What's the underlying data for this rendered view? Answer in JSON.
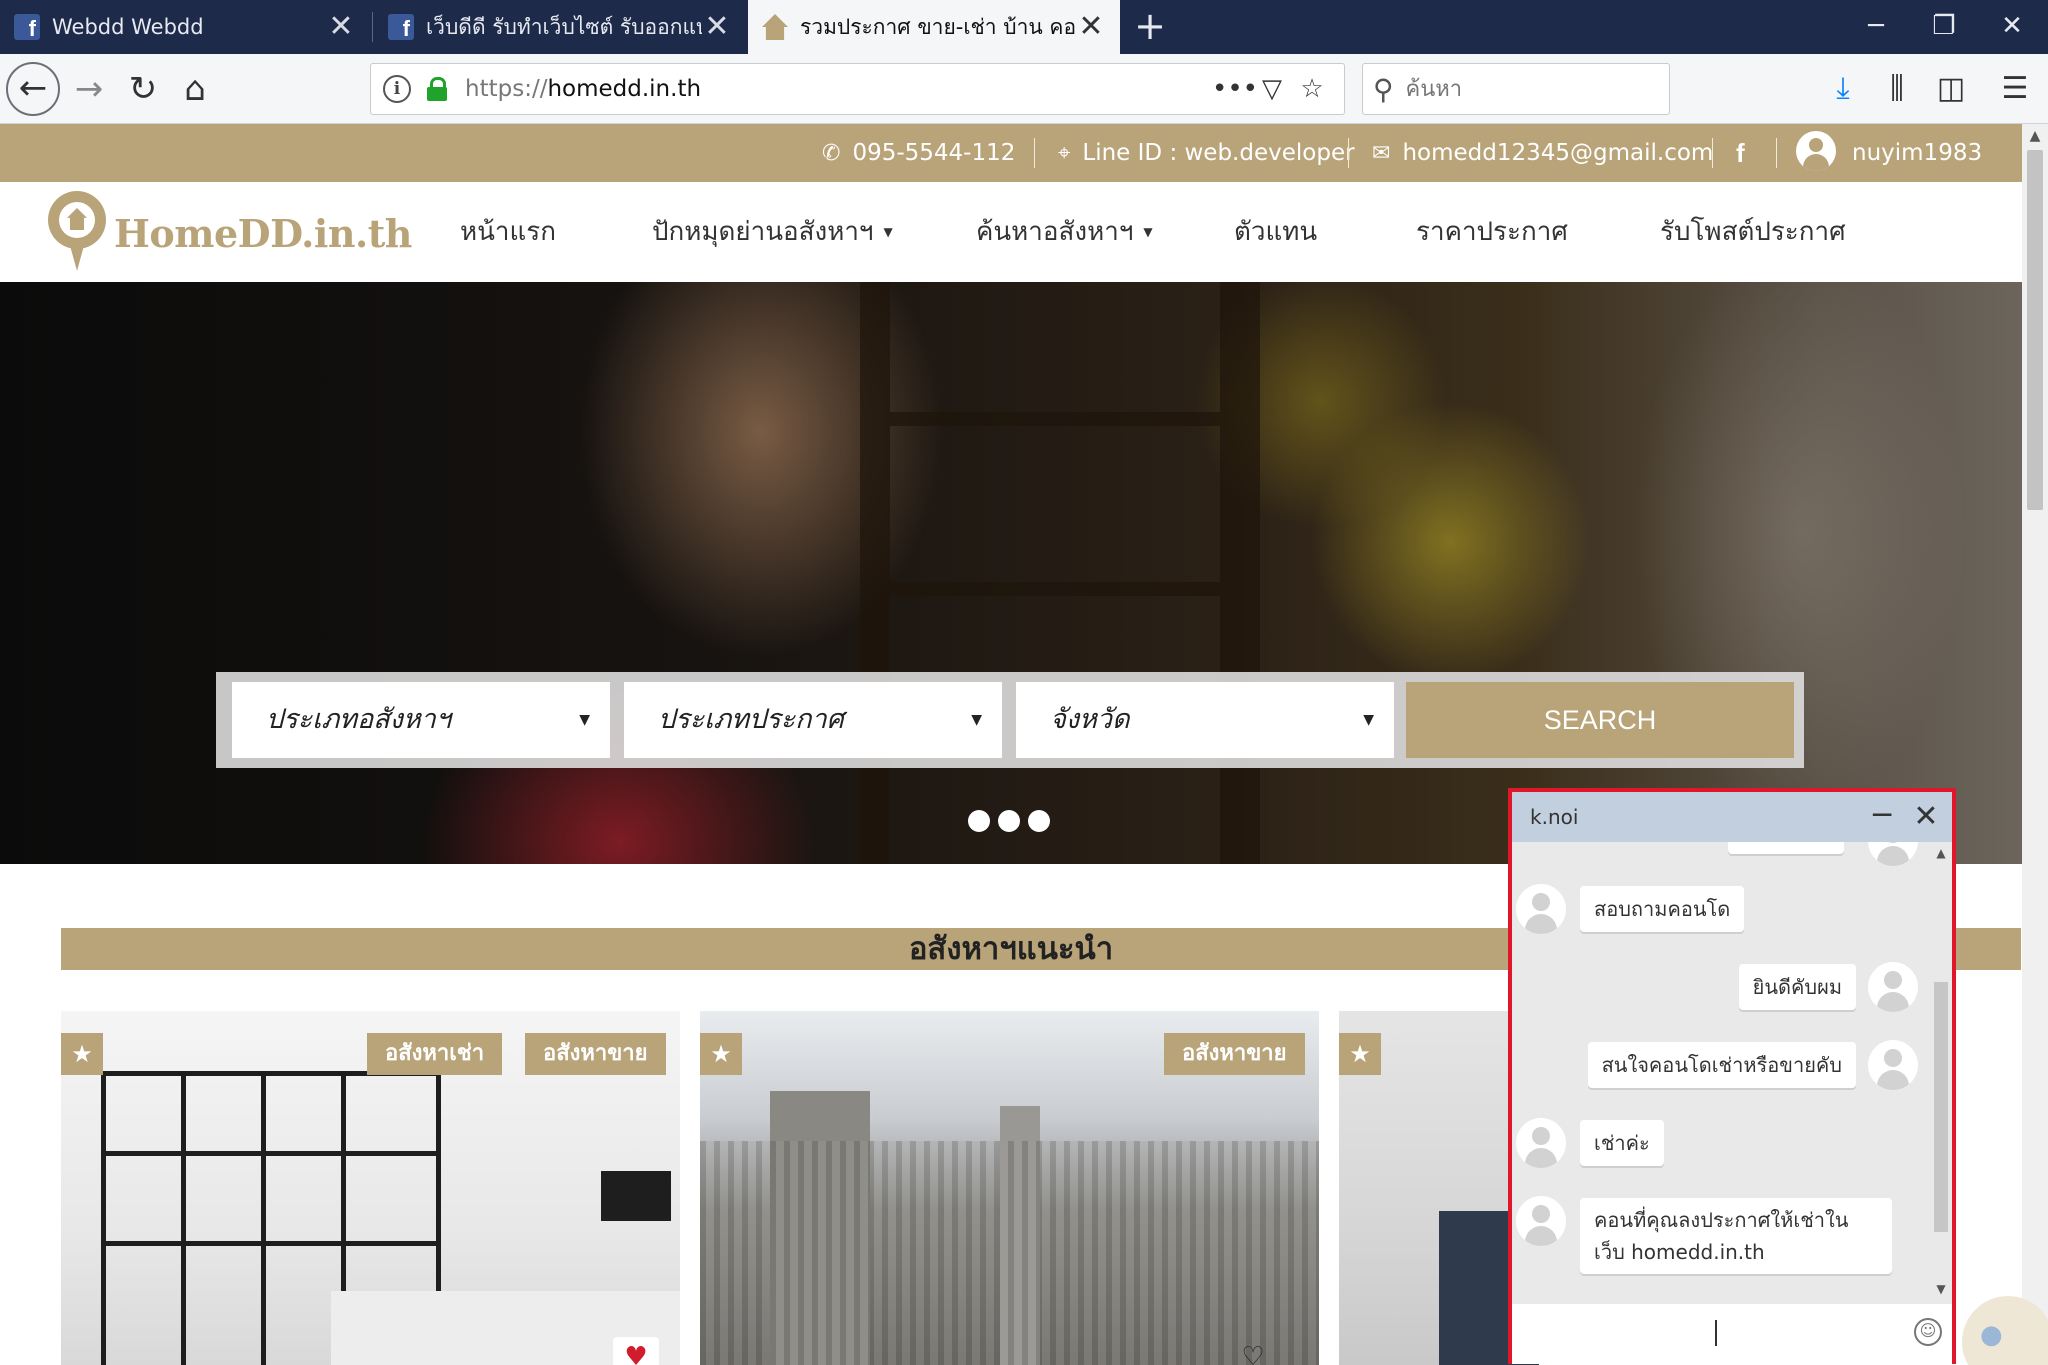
{
  "browser": {
    "tabs": [
      {
        "title": "Webdd Webdd",
        "icon": "facebook-icon",
        "active": false
      },
      {
        "title": "เว็บดีดี รับทำเว็บไซต์ รับออกแบบเว็บไซต์",
        "icon": "facebook-icon",
        "active": false
      },
      {
        "title": "รวมประกาศ ขาย-เช่า บ้าน คอนโด",
        "icon": "home-icon",
        "active": true
      }
    ],
    "url_proto": "https://",
    "url_host": "homedd.in.th",
    "search_placeholder": "ค้นหา",
    "glyphs": {
      "close": "✕",
      "plus": "+",
      "minimize": "─",
      "restore": "❐",
      "back": "←",
      "forward": "→",
      "reload": "↻",
      "home": "⌂",
      "more": "•••",
      "pocket": "▽",
      "star": "☆",
      "search": "⚲",
      "download": "⤓",
      "library": "⫼",
      "sidebar": "◫",
      "menu": "☰",
      "info": "i",
      "facebook": "f"
    }
  },
  "topinfo": {
    "phone": "095-5544-112",
    "line": "Line ID : web.developer",
    "email": "homedd12345@gmail.com",
    "facebook": "f",
    "username": "nuyim1983",
    "icons": {
      "phone": "✆",
      "pin": "⌖",
      "mail": "✉"
    }
  },
  "site": {
    "logo_text": "HomeDD.in.th",
    "menu": [
      {
        "label": "หน้าแรก",
        "dropdown": false
      },
      {
        "label": "ปักหมุดย่านอสังหาฯ",
        "dropdown": true
      },
      {
        "label": "ค้นหาอสังหาฯ",
        "dropdown": true
      },
      {
        "label": "ตัวแทน",
        "dropdown": false
      },
      {
        "label": "ราคาประกาศ",
        "dropdown": false
      },
      {
        "label": "รับโพสต์ประกาศ",
        "dropdown": false
      }
    ],
    "caret": "▼"
  },
  "hero": {
    "filters": [
      {
        "label": "ประเภทอสังหาฯ"
      },
      {
        "label": "ประเภทประกาศ"
      },
      {
        "label": "จังหวัด"
      }
    ],
    "search_label": "SEARCH",
    "caret": "▼",
    "slides": 3
  },
  "featured": {
    "title": "อสังหาฯแนะนำ",
    "star": "★",
    "heart_filled": "♥",
    "heart_outline": "♡",
    "cards": [
      {
        "labels": [
          "อสังหาเช่า",
          "อสังหาขาย"
        ]
      },
      {
        "labels": [
          "อสังหาขาย"
        ]
      },
      {
        "labels": []
      }
    ]
  },
  "chat": {
    "name": "k.noi",
    "minimize": "─",
    "close": "✕",
    "emoji": "☺",
    "messages": [
      {
        "side": "left",
        "text": "สอบถามคอนโด"
      },
      {
        "side": "right",
        "text": "ยินดีคับผม"
      },
      {
        "side": "right",
        "text": "สนใจคอนโดเช่าหรือขายคับ"
      },
      {
        "side": "left",
        "text": "เช่าค่ะ"
      },
      {
        "side": "left",
        "text": "คอนที่คุณลงประกาศให้เช่าในเว็บ homedd.in.th"
      }
    ],
    "launcher_icon": "chat-bubble-icon"
  },
  "colors": {
    "brand": "#b9a479",
    "tabbar": "#1d2a4a",
    "chat_header": "#c2cfdf",
    "highlight_border": "#e0162b"
  }
}
